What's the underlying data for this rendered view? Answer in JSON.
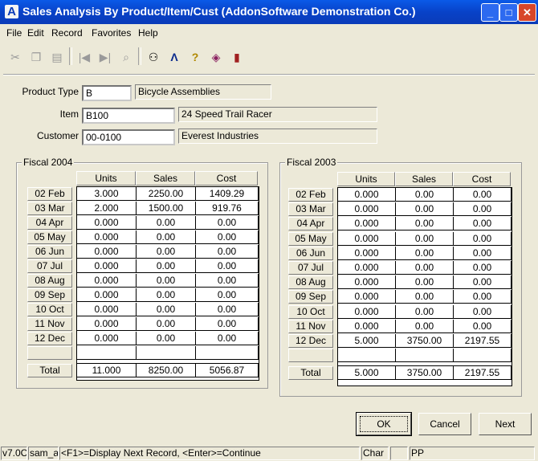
{
  "window": {
    "title": "Sales Analysis By Product/Item/Cust (AddonSoftware Demonstration Co.)"
  },
  "menu": [
    "File",
    "Edit",
    "Record",
    "Favorites",
    "Help"
  ],
  "toolbar": {
    "icons": [
      "cut-icon",
      "copy-icon",
      "paste-icon",
      "first-record-icon",
      "last-record-icon",
      "lookup-icon",
      "binoculars-icon",
      "addon-logo-icon",
      "help-icon",
      "book-icon",
      "exit-door-icon"
    ]
  },
  "fields": {
    "product_type_label": "Product Type",
    "product_type_value": "B",
    "product_type_desc": "Bicycle Assemblies",
    "item_label": "Item",
    "item_value": "B100",
    "item_desc": "24 Speed Trail Racer",
    "customer_label": "Customer",
    "customer_value": "00-0100",
    "customer_desc": "Everest Industries"
  },
  "columns": [
    "Units",
    "Sales",
    "Cost"
  ],
  "months": [
    "02 Feb",
    "03 Mar",
    "04 Apr",
    "05 May",
    "06 Jun",
    "07 Jul",
    "08 Aug",
    "09 Sep",
    "10 Oct",
    "11 Nov",
    "12 Dec"
  ],
  "total_label": "Total",
  "fiscal_2004": {
    "title": "Fiscal 2004",
    "rows": [
      [
        "3.000",
        "2250.00",
        "1409.29"
      ],
      [
        "2.000",
        "1500.00",
        "919.76"
      ],
      [
        "0.000",
        "0.00",
        "0.00"
      ],
      [
        "0.000",
        "0.00",
        "0.00"
      ],
      [
        "0.000",
        "0.00",
        "0.00"
      ],
      [
        "0.000",
        "0.00",
        "0.00"
      ],
      [
        "0.000",
        "0.00",
        "0.00"
      ],
      [
        "0.000",
        "0.00",
        "0.00"
      ],
      [
        "0.000",
        "0.00",
        "0.00"
      ],
      [
        "0.000",
        "0.00",
        "0.00"
      ],
      [
        "0.000",
        "0.00",
        "0.00"
      ]
    ],
    "total": [
      "11.000",
      "8250.00",
      "5056.87"
    ]
  },
  "fiscal_2003": {
    "title": "Fiscal 2003",
    "rows": [
      [
        "0.000",
        "0.00",
        "0.00"
      ],
      [
        "0.000",
        "0.00",
        "0.00"
      ],
      [
        "0.000",
        "0.00",
        "0.00"
      ],
      [
        "0.000",
        "0.00",
        "0.00"
      ],
      [
        "0.000",
        "0.00",
        "0.00"
      ],
      [
        "0.000",
        "0.00",
        "0.00"
      ],
      [
        "0.000",
        "0.00",
        "0.00"
      ],
      [
        "0.000",
        "0.00",
        "0.00"
      ],
      [
        "0.000",
        "0.00",
        "0.00"
      ],
      [
        "0.000",
        "0.00",
        "0.00"
      ],
      [
        "5.000",
        "3750.00",
        "2197.55"
      ]
    ],
    "total": [
      "5.000",
      "3750.00",
      "2197.55"
    ]
  },
  "buttons": {
    "ok": "OK",
    "cancel": "Cancel",
    "next": "Next"
  },
  "status": {
    "version": "v7.0C",
    "user": "sam_a",
    "message": "<F1>=Display Next Record, <Enter>=Continue",
    "mode": "Char",
    "empty": "",
    "code": "PP"
  }
}
